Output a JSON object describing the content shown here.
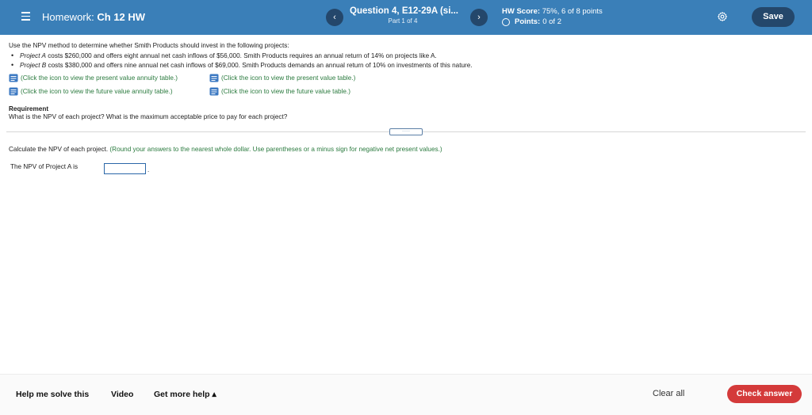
{
  "header": {
    "hw_label": "Homework:",
    "hw_name": "Ch 12 HW",
    "prev_icon": "‹",
    "next_icon": "›",
    "question_title": "Question 4, E12-29A (si...",
    "question_part": "Part 1 of 4",
    "score_label": "HW Score:",
    "score_value": "75%, 6 of 8 points",
    "points_label": "Points:",
    "points_value": "0 of 2",
    "save_label": "Save",
    "colors": {
      "bar": "#3a7fb8",
      "button": "#24476b"
    }
  },
  "content": {
    "intro": "Use the NPV method to determine whether Smith Products should invest in the following projects:",
    "project_a_name": "Project A",
    "project_a_text": " costs $260,000 and offers eight annual net cash inflows of $56,000. Smith Products requires an annual return of 14% on projects like A.",
    "project_b_name": "Project B",
    "project_b_text": " costs $380,000 and offers nine annual net cash inflows of $69,000. Smith Products demands an annual return of 10% on investments of this nature.",
    "links": [
      "(Click the icon to view the present value annuity table.)",
      "(Click the icon to view the present value table.)",
      "(Click the icon to view the future value annuity table.)",
      "(Click the icon to view the future value table.)"
    ],
    "requirement_head": "Requirement",
    "requirement_text": "What is the NPV of each project? What is the maximum acceptable price to pay for each project?",
    "expand_label": "·····",
    "calc_text": "Calculate the NPV of each project.",
    "calc_hint": " (Round your answers to the nearest whole dollar. Use parentheses or a minus sign for negative net present values.)",
    "npv_a_label": "The NPV of Project A is",
    "npv_a_value": "",
    "period": ".",
    "link_color": "#2a7a3e"
  },
  "footer": {
    "help_label": "Help me solve this",
    "video_label": "Video",
    "more_help_label": "Get more help ▴",
    "clear_label": "Clear all",
    "check_label": "Check answer",
    "check_color": "#d43a3a"
  }
}
